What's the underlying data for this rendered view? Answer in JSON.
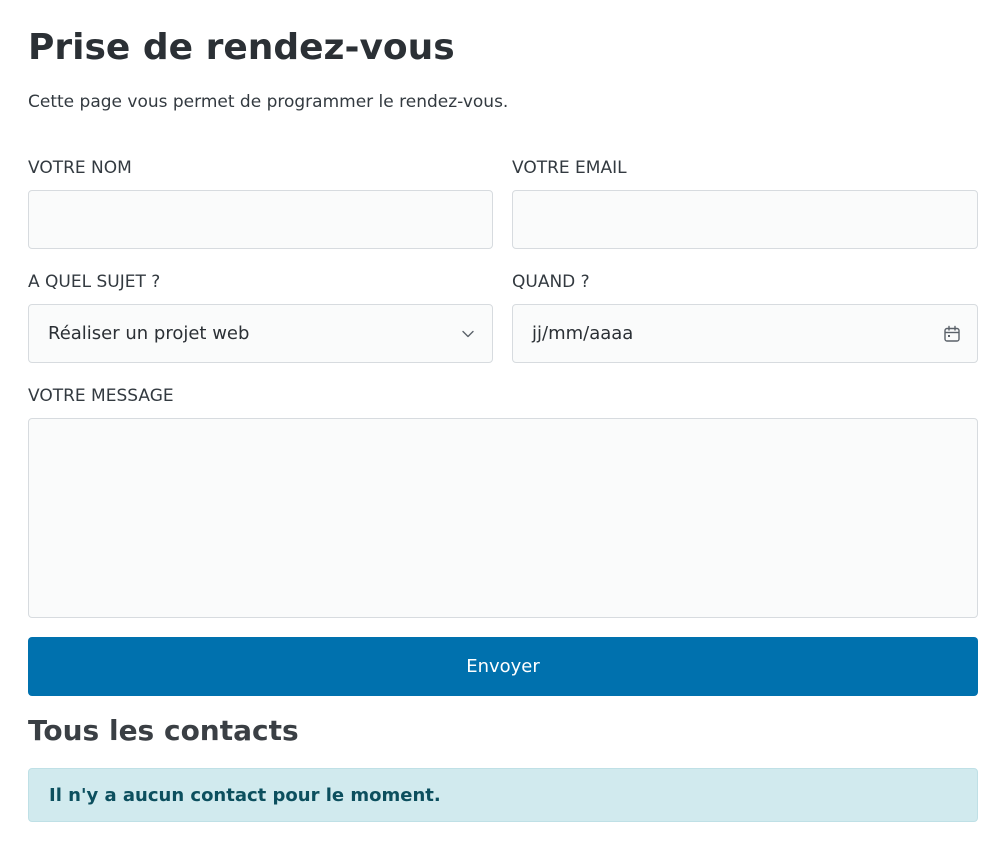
{
  "header": {
    "title": "Prise de rendez-vous",
    "intro": "Cette page vous permet de programmer le rendez-vous."
  },
  "form": {
    "name_label": "VOTRE NOM",
    "name_value": "",
    "email_label": "VOTRE EMAIL",
    "email_value": "",
    "subject_label": "A QUEL SUJET ?",
    "subject_selected": "Réaliser un projet web",
    "date_label": "QUAND ?",
    "date_placeholder": "jj/mm/aaaa",
    "message_label": "VOTRE MESSAGE",
    "message_value": "",
    "submit_label": "Envoyer"
  },
  "contacts": {
    "title": "Tous les contacts",
    "empty_message": "Il n'y a aucun contact pour le moment."
  },
  "colors": {
    "primary": "#0071ae",
    "info_background": "#d1eaee",
    "info_text": "#0c4f5e"
  },
  "icons": {
    "subject_select": "chevron-down-icon",
    "date_picker": "calendar-icon"
  }
}
